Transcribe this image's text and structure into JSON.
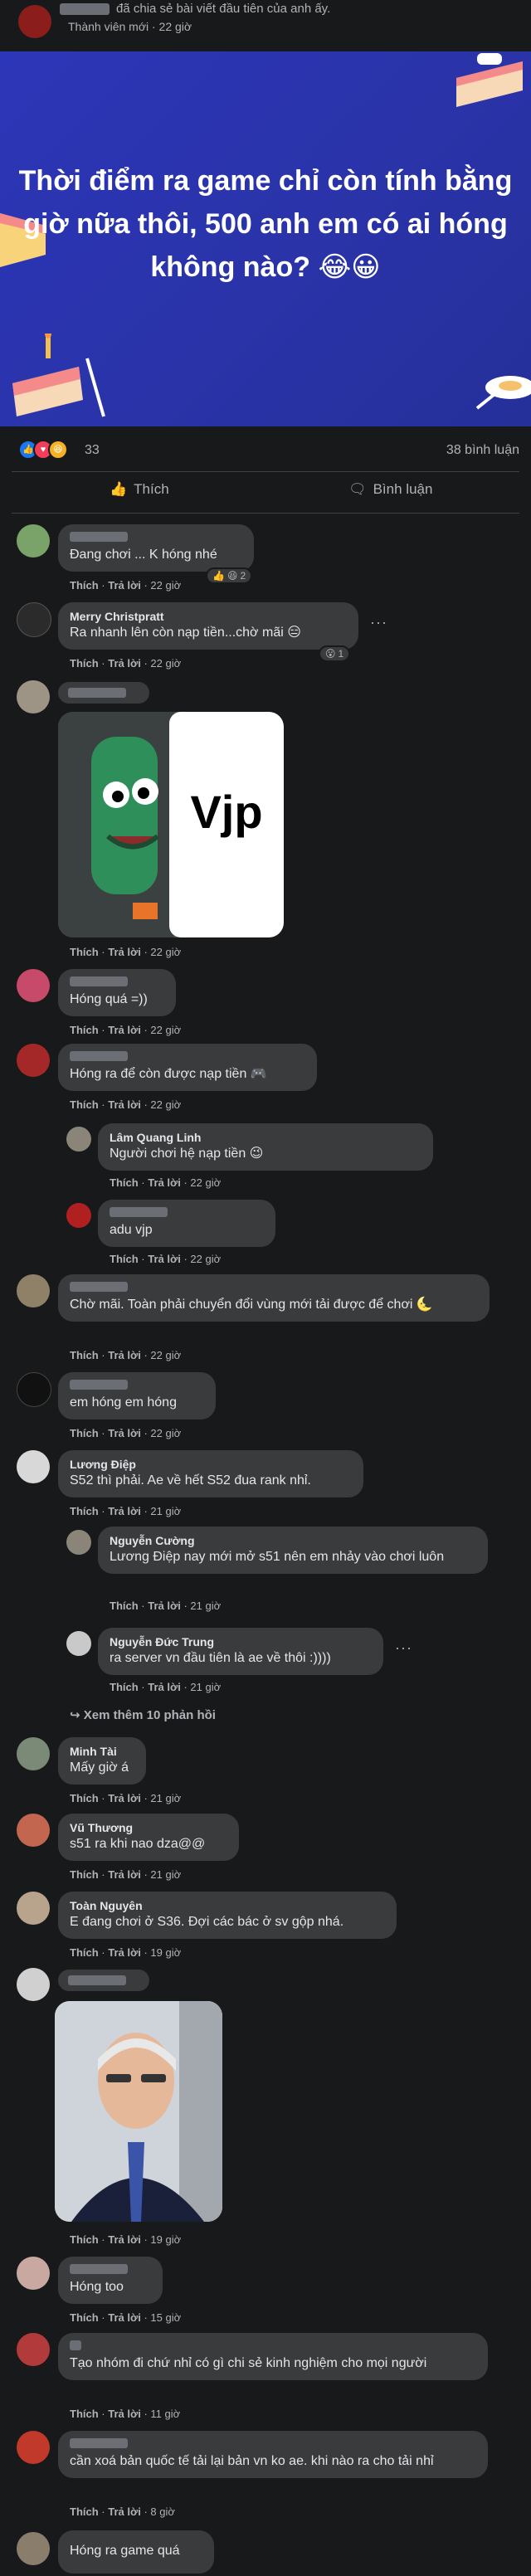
{
  "post": {
    "action_text": "đã chia sẻ bài viết đầu tiên của anh ấy.",
    "meta": "Thành viên mới · 22 giờ",
    "title": "Thời điểm ra game chỉ còn tính bằng giờ nữa thôi, 500 anh em có ai hóng không nào? 😂😀",
    "reaction_count": "33",
    "comment_count": "38 bình luận",
    "like_label": "Thích",
    "comment_label": "Bình luận"
  },
  "labels": {
    "like": "Thích",
    "reply": "Trả lời"
  },
  "comments": [
    {
      "name": "",
      "text": "Đang chơi ... K hóng nhé",
      "time": "22 giờ",
      "reactions": "2"
    },
    {
      "name": "Merry Christpratt",
      "text": "Ra nhanh lên còn nạp tiền...chờ mãi 😑",
      "time": "22 giờ",
      "reactions": "1"
    },
    {
      "name": "",
      "sticker_text": "Vjp",
      "time": "22 giờ"
    },
    {
      "name": "",
      "text": "Hóng quá =))",
      "time": "22 giờ"
    },
    {
      "name": "",
      "text": "Hóng ra để còn được nạp tiền 🎮",
      "time": "22 giờ"
    },
    {
      "name": "Lâm Quang Linh",
      "text": "Người chơi hệ nạp tiền 😉",
      "time": "22 giờ"
    },
    {
      "name": "",
      "text": "adu vjp",
      "time": "22 giờ"
    },
    {
      "name": "",
      "text": "Chờ mãi. Toàn phải chuyển đổi vùng mới tải được để chơi 🌜",
      "time": "22 giờ"
    },
    {
      "name": "",
      "text": "em hóng em hóng",
      "time": "22 giờ"
    },
    {
      "name": "Lương Điệp",
      "text": "S52 thì phải. Ae về hết S52 đua rank nhỉ.",
      "time": "21 giờ"
    },
    {
      "name": "Nguyễn Cường",
      "text": "Lương Điệp nay mới mở s51 nên em nhảy vào chơi luôn",
      "time": "21 giờ"
    },
    {
      "name": "Nguyễn Đức Trung",
      "text": "ra server vn đầu tiên là ae về thôi :))))",
      "time": "21 giờ"
    },
    {
      "name": "Minh Tài",
      "text": "Mấy giờ á",
      "time": "21 giờ"
    },
    {
      "name": "Vũ Thương",
      "text": "s51 ra khi nao dza@@",
      "time": "21 giờ"
    },
    {
      "name": "Toàn Nguyên",
      "text": "E đang chơi ở S36. Đợi các bác ở sv gộp nhá.",
      "time": "19 giờ"
    },
    {
      "name": "",
      "time": "19 giờ"
    },
    {
      "name": "",
      "text": "Hóng too",
      "time": "15 giờ"
    },
    {
      "name": "",
      "text": "Tạo nhóm đi chứ nhỉ có gì chi sẻ kinh nghiệm cho mọi người",
      "time": "11 giờ"
    },
    {
      "name": "",
      "text": "cần xoá bản quốc tế tải lại bản vn ko ae. khi nào ra cho tải nhỉ",
      "time": "8 giờ"
    },
    {
      "name": "",
      "text": "Hóng ra game quá"
    }
  ],
  "more_replies": "Xem thêm 10 phản hồi",
  "colors": {
    "banner": "#2c36b8",
    "bg": "#18191a",
    "bubble": "#3a3b3c",
    "like_blue": "#1877f2"
  }
}
